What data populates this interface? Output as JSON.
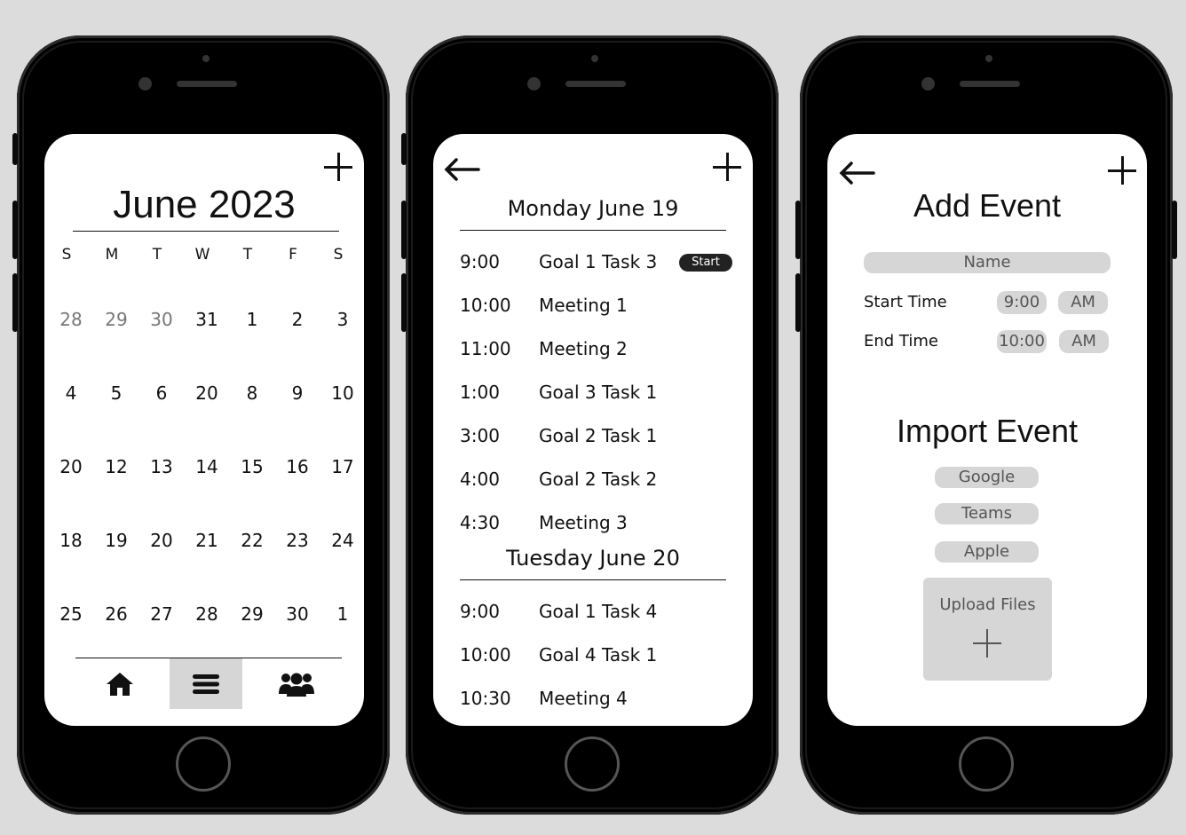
{
  "calendar_screen": {
    "month_title": "June 2023",
    "weekdays": [
      "S",
      "M",
      "T",
      "W",
      "T",
      "F",
      "S"
    ],
    "weeks": [
      [
        {
          "d": "28",
          "muted": true
        },
        {
          "d": "29",
          "muted": true
        },
        {
          "d": "30",
          "muted": true
        },
        {
          "d": "31"
        },
        {
          "d": "1"
        },
        {
          "d": "2"
        },
        {
          "d": "3"
        }
      ],
      [
        {
          "d": "4"
        },
        {
          "d": "5"
        },
        {
          "d": "6"
        },
        {
          "d": "20"
        },
        {
          "d": "8"
        },
        {
          "d": "9"
        },
        {
          "d": "10"
        }
      ],
      [
        {
          "d": "20"
        },
        {
          "d": "12"
        },
        {
          "d": "13"
        },
        {
          "d": "14"
        },
        {
          "d": "15"
        },
        {
          "d": "16"
        },
        {
          "d": "17"
        }
      ],
      [
        {
          "d": "18"
        },
        {
          "d": "19"
        },
        {
          "d": "20"
        },
        {
          "d": "21"
        },
        {
          "d": "22"
        },
        {
          "d": "23"
        },
        {
          "d": "24"
        }
      ],
      [
        {
          "d": "25"
        },
        {
          "d": "26"
        },
        {
          "d": "27"
        },
        {
          "d": "28"
        },
        {
          "d": "29"
        },
        {
          "d": "30"
        },
        {
          "d": "1"
        }
      ]
    ],
    "nav": [
      {
        "icon": "home-icon",
        "active": false
      },
      {
        "icon": "menu-icon",
        "active": true
      },
      {
        "icon": "group-icon",
        "active": false
      }
    ]
  },
  "schedule_screen": {
    "days": [
      {
        "heading": "Monday June 19",
        "events": [
          {
            "time": "9:00",
            "title": "Goal 1 Task 3",
            "badge": "Start"
          },
          {
            "time": "10:00",
            "title": "Meeting 1"
          },
          {
            "time": "11:00",
            "title": "Meeting 2"
          },
          {
            "time": "1:00",
            "title": "Goal 3 Task 1"
          },
          {
            "time": "3:00",
            "title": "Goal 2 Task 1"
          },
          {
            "time": "4:00",
            "title": "Goal 2 Task 2"
          },
          {
            "time": "4:30",
            "title": "Meeting 3"
          }
        ]
      },
      {
        "heading": "Tuesday June 20",
        "events": [
          {
            "time": "9:00",
            "title": "Goal 1 Task 4"
          },
          {
            "time": "10:00",
            "title": "Goal 4 Task 1"
          },
          {
            "time": "10:30",
            "title": "Meeting 4"
          }
        ]
      }
    ]
  },
  "add_event_screen": {
    "title": "Add Event",
    "name_placeholder": "Name",
    "start_time_label": "Start Time",
    "start_time_value": "9:00",
    "start_ampm": "AM",
    "end_time_label": "End Time",
    "end_time_value": "10:00",
    "end_ampm": "AM",
    "import_title": "Import Event",
    "import_sources": [
      "Google",
      "Teams",
      "Apple"
    ],
    "upload_label": "Upload Files"
  }
}
